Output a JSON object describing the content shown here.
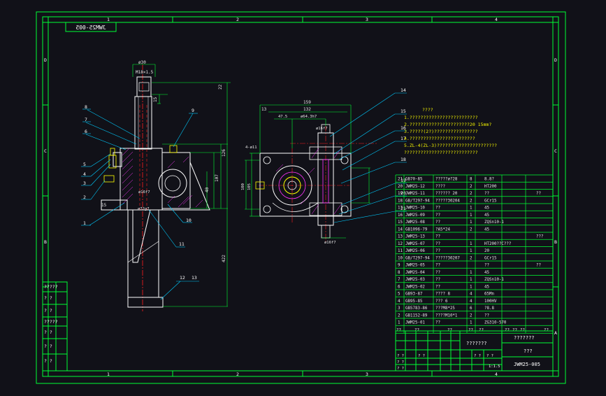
{
  "drawing": {
    "number_mirrored": "JWM25-005",
    "title_number": "JWM25-005",
    "title_cn": "???????",
    "subtitle_cn": "???",
    "scale": "1:1.5",
    "zone_columns": [
      "1",
      "2",
      "3",
      "4"
    ],
    "zone_rows": [
      "D",
      "C",
      "B",
      "A"
    ]
  },
  "dimensions": {
    "top_dia": "ø30",
    "thread": "M18×1.5",
    "d22": "22",
    "d15": "15",
    "d126": "126",
    "d107": "107",
    "d40": "40",
    "d15b": "15",
    "d422": "422",
    "d16f7": "ø16f7",
    "d72g7": "ø72g7",
    "w159": "159",
    "w13": "13",
    "w132": "132",
    "w475": "47.5",
    "w643": "ø64.3h7",
    "hole": "4-ø11",
    "d16f7b": "ø16f7",
    "side105": "105",
    "side100": "100",
    "bottom16f7": "ø16f7"
  },
  "balloons_front": [
    "8",
    "7",
    "6",
    "5",
    "4",
    "3",
    "2",
    "1",
    "9",
    "10",
    "11",
    "12",
    "13"
  ],
  "balloons_side": [
    "14",
    "15",
    "16",
    "17",
    "18",
    "19",
    "20",
    "21"
  ],
  "notes": {
    "title": "????",
    "lines": [
      "1.?????????????????????????",
      "2.??????????????????????20 15mm?",
      "3.?????(2?)????????????????",
      "4.????????????????????????",
      "5.ZL-4(ZL-3)??????????????????????",
      "???????????????????????????"
    ]
  },
  "bom": [
    {
      "no": "21",
      "code": "GB70-85",
      "name": "?????ø?28",
      "qty": "8",
      "material": "8.8?",
      "remark": ""
    },
    {
      "no": "20",
      "code": "JWM25-12",
      "name": "????",
      "qty": "2",
      "material": "HT200",
      "remark": ""
    },
    {
      "no": "19",
      "code": "JWM25-11",
      "name": "?????? 20",
      "qty": "2",
      "material": "??",
      "remark": "??"
    },
    {
      "no": "18",
      "code": "GB/T297-94",
      "name": "?????30204",
      "qty": "2",
      "material": "GCr15",
      "remark": ""
    },
    {
      "no": "17",
      "code": "JWM25-10",
      "name": "??",
      "qty": "1",
      "material": "45",
      "remark": ""
    },
    {
      "no": "16",
      "code": "JWM25-09",
      "name": "??",
      "qty": "1",
      "material": "45",
      "remark": ""
    },
    {
      "no": "15",
      "code": "JWM25-08",
      "name": "??",
      "qty": "1",
      "material": "ZQSn10-1",
      "remark": ""
    },
    {
      "no": "14",
      "code": "GB1096-79",
      "name": "?A5*24",
      "qty": "2",
      "material": "45",
      "remark": ""
    },
    {
      "no": "13",
      "code": "JWM25-13",
      "name": "??",
      "qty": "",
      "material": "",
      "remark": "???"
    },
    {
      "no": "12",
      "code": "JWM25-07",
      "name": "??",
      "qty": "1",
      "material": "HT200??C???",
      "remark": ""
    },
    {
      "no": "11",
      "code": "JWM25-06",
      "name": "??",
      "qty": "1",
      "material": "20",
      "remark": ""
    },
    {
      "no": "10",
      "code": "GB/T297-94",
      "name": "?????30207",
      "qty": "2",
      "material": "GCr15",
      "remark": ""
    },
    {
      "no": "9",
      "code": "JWM25-05",
      "name": "??",
      "qty": "",
      "material": "??",
      "remark": "??"
    },
    {
      "no": "8",
      "code": "JWM25-04",
      "name": "??",
      "qty": "1",
      "material": "45",
      "remark": ""
    },
    {
      "no": "7",
      "code": "JWM25-03",
      "name": "??",
      "qty": "1",
      "material": "ZQSn10-1",
      "remark": ""
    },
    {
      "no": "6",
      "code": "JWM25-02",
      "name": "??",
      "qty": "1",
      "material": "45",
      "remark": ""
    },
    {
      "no": "5",
      "code": "GB93-87",
      "name": "???? 8",
      "qty": "4",
      "material": "65Mn",
      "remark": ""
    },
    {
      "no": "4",
      "code": "GB95-85",
      "name": "??? 6",
      "qty": "4",
      "material": "100HV",
      "remark": ""
    },
    {
      "no": "3",
      "code": "GB5783-86",
      "name": "???M8*25",
      "qty": "6",
      "material": "?8.8",
      "remark": ""
    },
    {
      "no": "2",
      "code": "GB1152-89",
      "name": "????M10*1",
      "qty": "2",
      "material": "??",
      "remark": ""
    },
    {
      "no": "1",
      "code": "JWM25-01",
      "name": "??",
      "qty": "1",
      "material": "ZG310-570",
      "remark": ""
    }
  ],
  "bom_header": {
    "no": "??",
    "code": "??",
    "name": "??",
    "qty": "??",
    "material": "??",
    "r1": "??",
    "r2": "??",
    "r3": "??",
    "remark": "??"
  },
  "left_stamps": [
    "?????",
    "? ?",
    "? ?",
    "?????",
    "? ?",
    "? ?",
    "? ?"
  ],
  "title_block_small": [
    "? ?",
    "? ?",
    "? ?",
    "? ?",
    "? ?",
    "? ?"
  ],
  "colors": {
    "frame": "#00ff33",
    "part": "#ffffff",
    "dim": "#00ff33",
    "center": "#ff2020",
    "leader": "#00ccff",
    "hatch": "#ff33ff",
    "note": "#f0f000"
  }
}
